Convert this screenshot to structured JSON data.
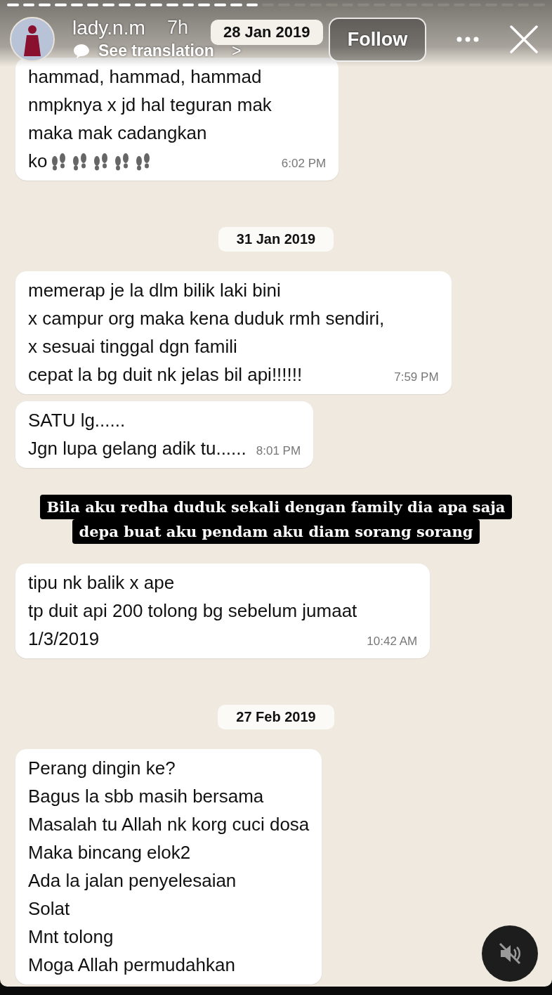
{
  "story": {
    "progress": [
      {
        "seen": true
      },
      {
        "seen": true
      },
      {
        "seen": true
      },
      {
        "seen": true
      },
      {
        "seen": true
      },
      {
        "seen": true
      },
      {
        "seen": true
      },
      {
        "seen": true
      },
      {
        "seen": true
      },
      {
        "seen": true
      },
      {
        "seen": true
      },
      {
        "seen": true
      },
      {
        "seen": true
      },
      {
        "seen": true
      },
      {
        "seen": true
      },
      {
        "seen": true
      },
      {
        "seen": false
      },
      {
        "seen": false
      },
      {
        "seen": false
      },
      {
        "seen": false
      },
      {
        "seen": false
      },
      {
        "seen": false
      },
      {
        "seen": false
      },
      {
        "seen": false
      },
      {
        "seen": false
      },
      {
        "seen": false
      },
      {
        "seen": false
      },
      {
        "seen": false
      },
      {
        "seen": false
      },
      {
        "seen": false
      },
      {
        "seen": false
      },
      {
        "seen": false
      },
      {
        "seen": false
      },
      {
        "seen": false
      }
    ],
    "username": "lady.n.m",
    "age": "7h",
    "translate": "See translation",
    "translate_arrow": ">",
    "follow": "Follow",
    "muted": true
  },
  "chat": [
    {
      "kind": "message",
      "lines": [
        "hammad, hammad, hammad",
        "nmpknya x jd hal teguran mak",
        "maka mak cadangkan",
        "ko"
      ],
      "footprints": true,
      "time": "6:02 PM"
    },
    {
      "kind": "date",
      "text": "31 Jan 2019"
    },
    {
      "kind": "message",
      "lines": [
        "memerap je la dlm bilik laki bini",
        "x campur org maka kena duduk rmh sendiri,",
        "x sesuai tinggal dgn famili",
        "cepat la bg duit nk jelas bil api!!!!!!"
      ],
      "time": "7:59 PM"
    },
    {
      "kind": "message",
      "lines": [
        "SATU lg......",
        "Jgn lupa gelang adik tu......"
      ],
      "time": "8:01 PM"
    },
    {
      "kind": "caption",
      "lines": [
        "Bila aku redha duduk sekali dengan family dia apa saja",
        "depa buat aku pendam aku diam sorang sorang"
      ]
    },
    {
      "kind": "message",
      "lines": [
        "tipu nk balik x ape",
        "tp duit api 200 tolong bg sebelum jumaat",
        "1/3/2019"
      ],
      "time": "10:42 AM"
    },
    {
      "kind": "date",
      "text": "27 Feb 2019"
    },
    {
      "kind": "message",
      "lines": [
        "Perang dingin ke?",
        "Bagus la sbb masih bersama",
        "Masalah tu Allah nk korg cuci dosa",
        "Maka bincang elok2",
        "Ada la jalan penyelesaian",
        "Solat",
        "Mnt tolong",
        "Moga Allah permudahkan"
      ]
    }
  ],
  "top_date": "28 Jan 2019"
}
